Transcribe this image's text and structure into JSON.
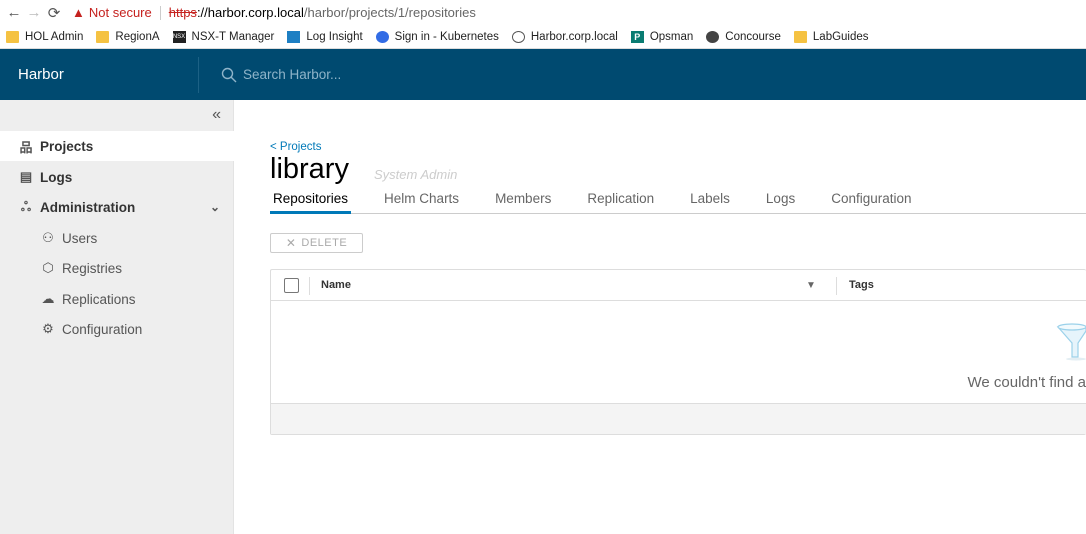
{
  "browser": {
    "warning": "Not secure",
    "url_scheme": "https",
    "url_host": "://harbor.corp.local",
    "url_path": "/harbor/projects/1/repositories"
  },
  "bookmarks": [
    {
      "label": "HOL Admin",
      "icon": "folder"
    },
    {
      "label": "RegionA",
      "icon": "folder"
    },
    {
      "label": "NSX-T Manager",
      "icon": "nsx"
    },
    {
      "label": "Log Insight",
      "icon": "log"
    },
    {
      "label": "Sign in - Kubernetes",
      "icon": "k8s"
    },
    {
      "label": "Harbor.corp.local",
      "icon": "harbor"
    },
    {
      "label": "Opsman",
      "icon": "p"
    },
    {
      "label": "Concourse",
      "icon": "conc"
    },
    {
      "label": "LabGuides",
      "icon": "folder"
    }
  ],
  "header": {
    "brand": "Harbor",
    "search_placeholder": "Search Harbor..."
  },
  "sidebar": {
    "items": [
      {
        "label": "Projects",
        "icon": "projects-icon"
      },
      {
        "label": "Logs",
        "icon": "logs-icon"
      },
      {
        "label": "Administration",
        "icon": "administration-icon"
      },
      {
        "label": "Users",
        "icon": "users-icon"
      },
      {
        "label": "Registries",
        "icon": "registries-icon"
      },
      {
        "label": "Replications",
        "icon": "replications-icon"
      },
      {
        "label": "Configuration",
        "icon": "configuration-icon"
      }
    ]
  },
  "main": {
    "breadcrumb": "< Projects",
    "title": "library",
    "role": "System Admin",
    "tabs": [
      {
        "label": "Repositories"
      },
      {
        "label": "Helm Charts"
      },
      {
        "label": "Members"
      },
      {
        "label": "Replication"
      },
      {
        "label": "Labels"
      },
      {
        "label": "Logs"
      },
      {
        "label": "Configuration"
      }
    ],
    "delete_label": "DELETE",
    "grid": {
      "col_name": "Name",
      "col_tags": "Tags",
      "empty_text": "We couldn't find a"
    }
  },
  "colors": {
    "header_bg": "#004a70",
    "accent": "#0079b8",
    "warning": "#c5221f"
  }
}
